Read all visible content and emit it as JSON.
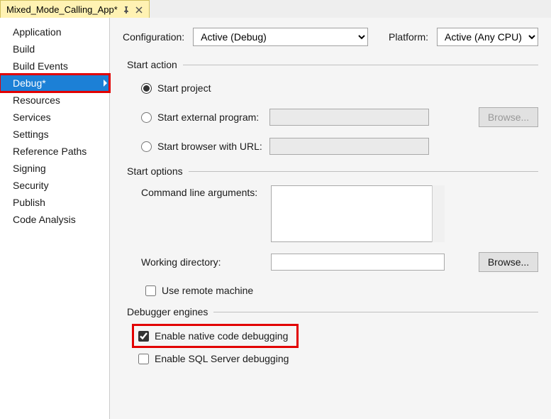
{
  "tab": {
    "title": "Mixed_Mode_Calling_App*"
  },
  "sidebar": {
    "items": [
      {
        "label": "Application"
      },
      {
        "label": "Build"
      },
      {
        "label": "Build Events"
      },
      {
        "label": "Debug*",
        "active": true,
        "highlight": true
      },
      {
        "label": "Resources"
      },
      {
        "label": "Services"
      },
      {
        "label": "Settings"
      },
      {
        "label": "Reference Paths"
      },
      {
        "label": "Signing"
      },
      {
        "label": "Security"
      },
      {
        "label": "Publish"
      },
      {
        "label": "Code Analysis"
      }
    ]
  },
  "header": {
    "configuration_label": "Configuration:",
    "configuration_value": "Active (Debug)",
    "platform_label": "Platform:",
    "platform_value": "Active (Any CPU)"
  },
  "sections": {
    "start_action": {
      "title": "Start action",
      "start_project": "Start project",
      "start_external": "Start external program:",
      "start_browser": "Start browser with URL:",
      "browse": "Browse..."
    },
    "start_options": {
      "title": "Start options",
      "cmd_args": "Command line arguments:",
      "working_dir": "Working directory:",
      "use_remote": "Use remote machine",
      "browse": "Browse..."
    },
    "debugger": {
      "title": "Debugger engines",
      "enable_native": "Enable native code debugging",
      "enable_sql": "Enable SQL Server debugging"
    }
  }
}
